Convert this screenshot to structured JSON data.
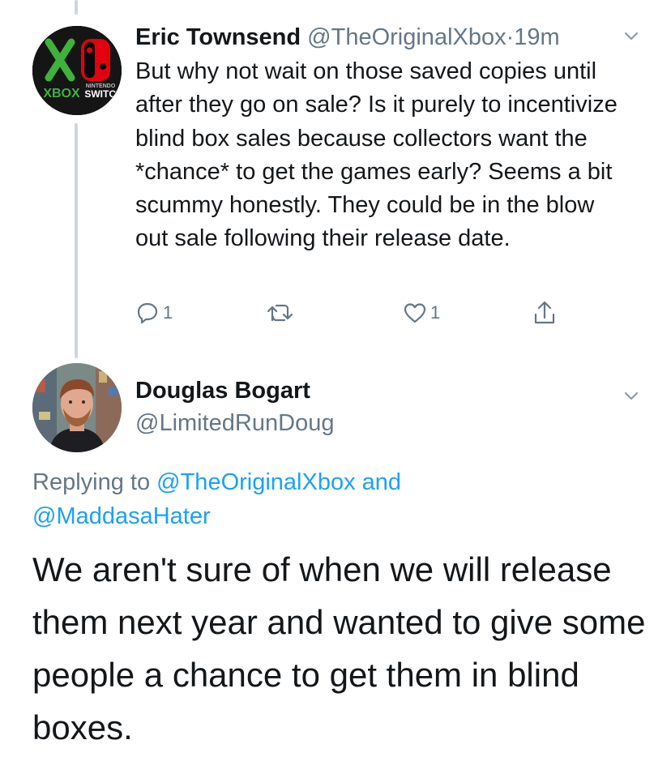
{
  "tweet1": {
    "display_name": "Eric Townsend",
    "handle": "@TheOriginalXbox",
    "separator": "·",
    "time": "19m",
    "body": "But why not wait on those saved copies until after they go on sale? Is it purely to incentivize blind box sales because collectors want the *chance* to get the games early? Seems a bit scummy honestly. They could be in the blow out sale following their release date.",
    "avatar": {
      "top_text": "NINTENDO",
      "left_text": "XBOX",
      "right_text": "SWITCH",
      "accent_green": "#3fb23b",
      "accent_red": "#e4000f"
    },
    "actions": {
      "reply_icon": "reply-icon",
      "reply_count": "1",
      "retweet_icon": "retweet-icon",
      "like_icon": "heart-icon",
      "like_count": "1",
      "share_icon": "share-icon"
    }
  },
  "tweet2": {
    "display_name": "Douglas Bogart",
    "handle": "@LimitedRunDoug",
    "replying_prefix": "Replying to ",
    "mention_1": "@TheOriginalXbox",
    "connector": " and",
    "mention_2": "@MaddasaHater",
    "body": "We aren't sure of when we will release them next year and wanted to give some people a chance to get them in blind boxes."
  },
  "colors": {
    "text_primary": "#14171a",
    "text_secondary": "#657786",
    "link": "#1da1f2",
    "thread_line": "#ccd6dd"
  }
}
